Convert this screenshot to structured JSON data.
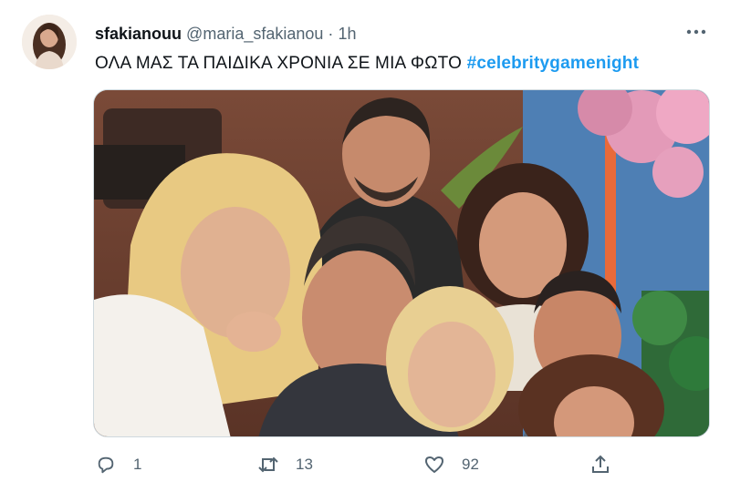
{
  "tweet": {
    "display_name": "sfakianouu",
    "handle": "@maria_sfakianou",
    "separator": "·",
    "time": "1h",
    "text": "ΟΛΑ ΜΑΣ ΤΑ ΠΑΙΔΙΚΑ ΧΡΟΝΙΑ ΣΕ ΜΙΑ ΦΩΤΟ",
    "hashtag": "#celebritygamenight"
  },
  "actions": {
    "reply_icon": "reply-icon",
    "reply_count": "1",
    "retweet_icon": "retweet-icon",
    "retweet_count": "13",
    "like_icon": "heart-icon",
    "like_count": "92",
    "share_icon": "share-icon"
  },
  "colors": {
    "hashtag": "#1d9bf0",
    "secondary_text": "#536471",
    "primary_text": "#0f1419"
  }
}
